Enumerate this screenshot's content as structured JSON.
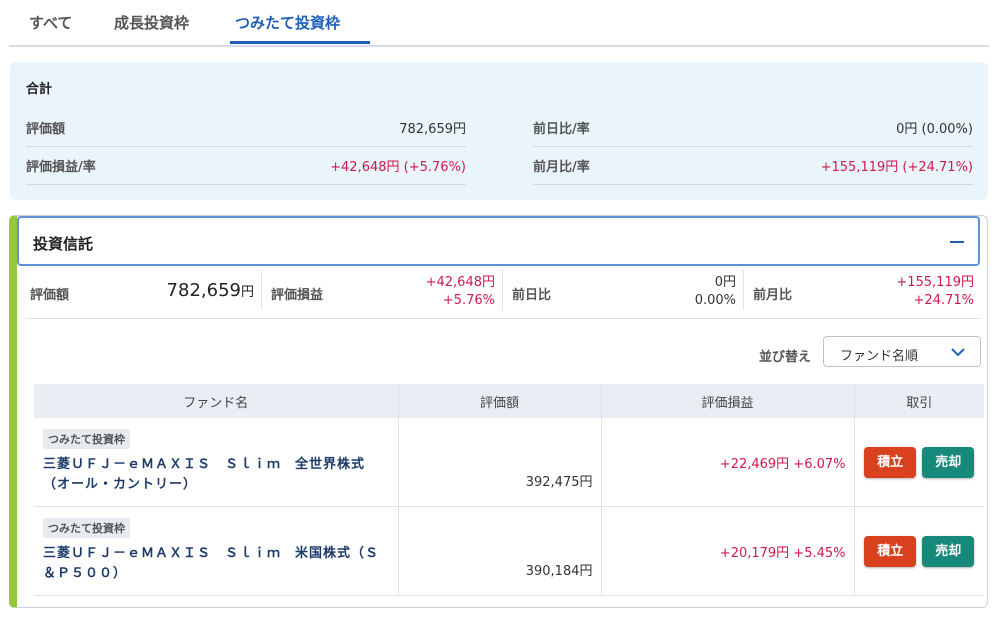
{
  "tabs": [
    "すべて",
    "成長投資枠",
    "つみたて投資枠"
  ],
  "summary": {
    "title": "合計",
    "valuation_label": "評価額",
    "valuation_value": "782,659円",
    "pl_label": "評価損益/率",
    "pl_value": "+42,648円 (+5.76%)",
    "dod_label": "前日比/率",
    "dod_value": "0円 (0.00%)",
    "mom_label": "前月比/率",
    "mom_value": "+155,119円 (+24.71%)"
  },
  "trust": {
    "title": "投資信託",
    "valuation_label": "評価額",
    "valuation_number": "782,659",
    "valuation_unit": "円",
    "pl_label": "評価損益",
    "pl_amount": "+42,648円",
    "pl_rate": "+5.76%",
    "dod_label": "前日比",
    "dod_amount": "0円",
    "dod_rate": "0.00%",
    "mom_label": "前月比",
    "mom_amount": "+155,119円",
    "mom_rate": "+24.71%",
    "sort_label": "並び替え",
    "sort_value": "ファンド名順"
  },
  "table": {
    "headers": [
      "ファンド名",
      "評価額",
      "評価損益",
      "取引"
    ],
    "rows": [
      {
        "tag": "つみたて投資枠",
        "name": "三菱ＵＦＪ－ｅＭＡＸＩＳ　Ｓｌｉｍ　全世界株式（オール・カントリー）",
        "value": "392,475円",
        "pl": "+22,469円 +6.07%",
        "buy_label": "積立",
        "sell_label": "売却"
      },
      {
        "tag": "つみたて投資枠",
        "name": "三菱ＵＦＪ－ｅＭＡＸＩＳ　Ｓｌｉｍ　米国株式（Ｓ＆Ｐ５００）",
        "value": "390,184円",
        "pl": "+20,179円 +5.45%",
        "buy_label": "積立",
        "sell_label": "売却"
      }
    ]
  },
  "colors": {
    "accent": "#1f5fb8",
    "positive": "#d0194a",
    "buy": "#d9401e",
    "sell": "#17897a",
    "card_stripe": "#93c83f"
  },
  "icons": {
    "collapse": "minus-icon",
    "dropdown": "chevron-down-icon"
  }
}
